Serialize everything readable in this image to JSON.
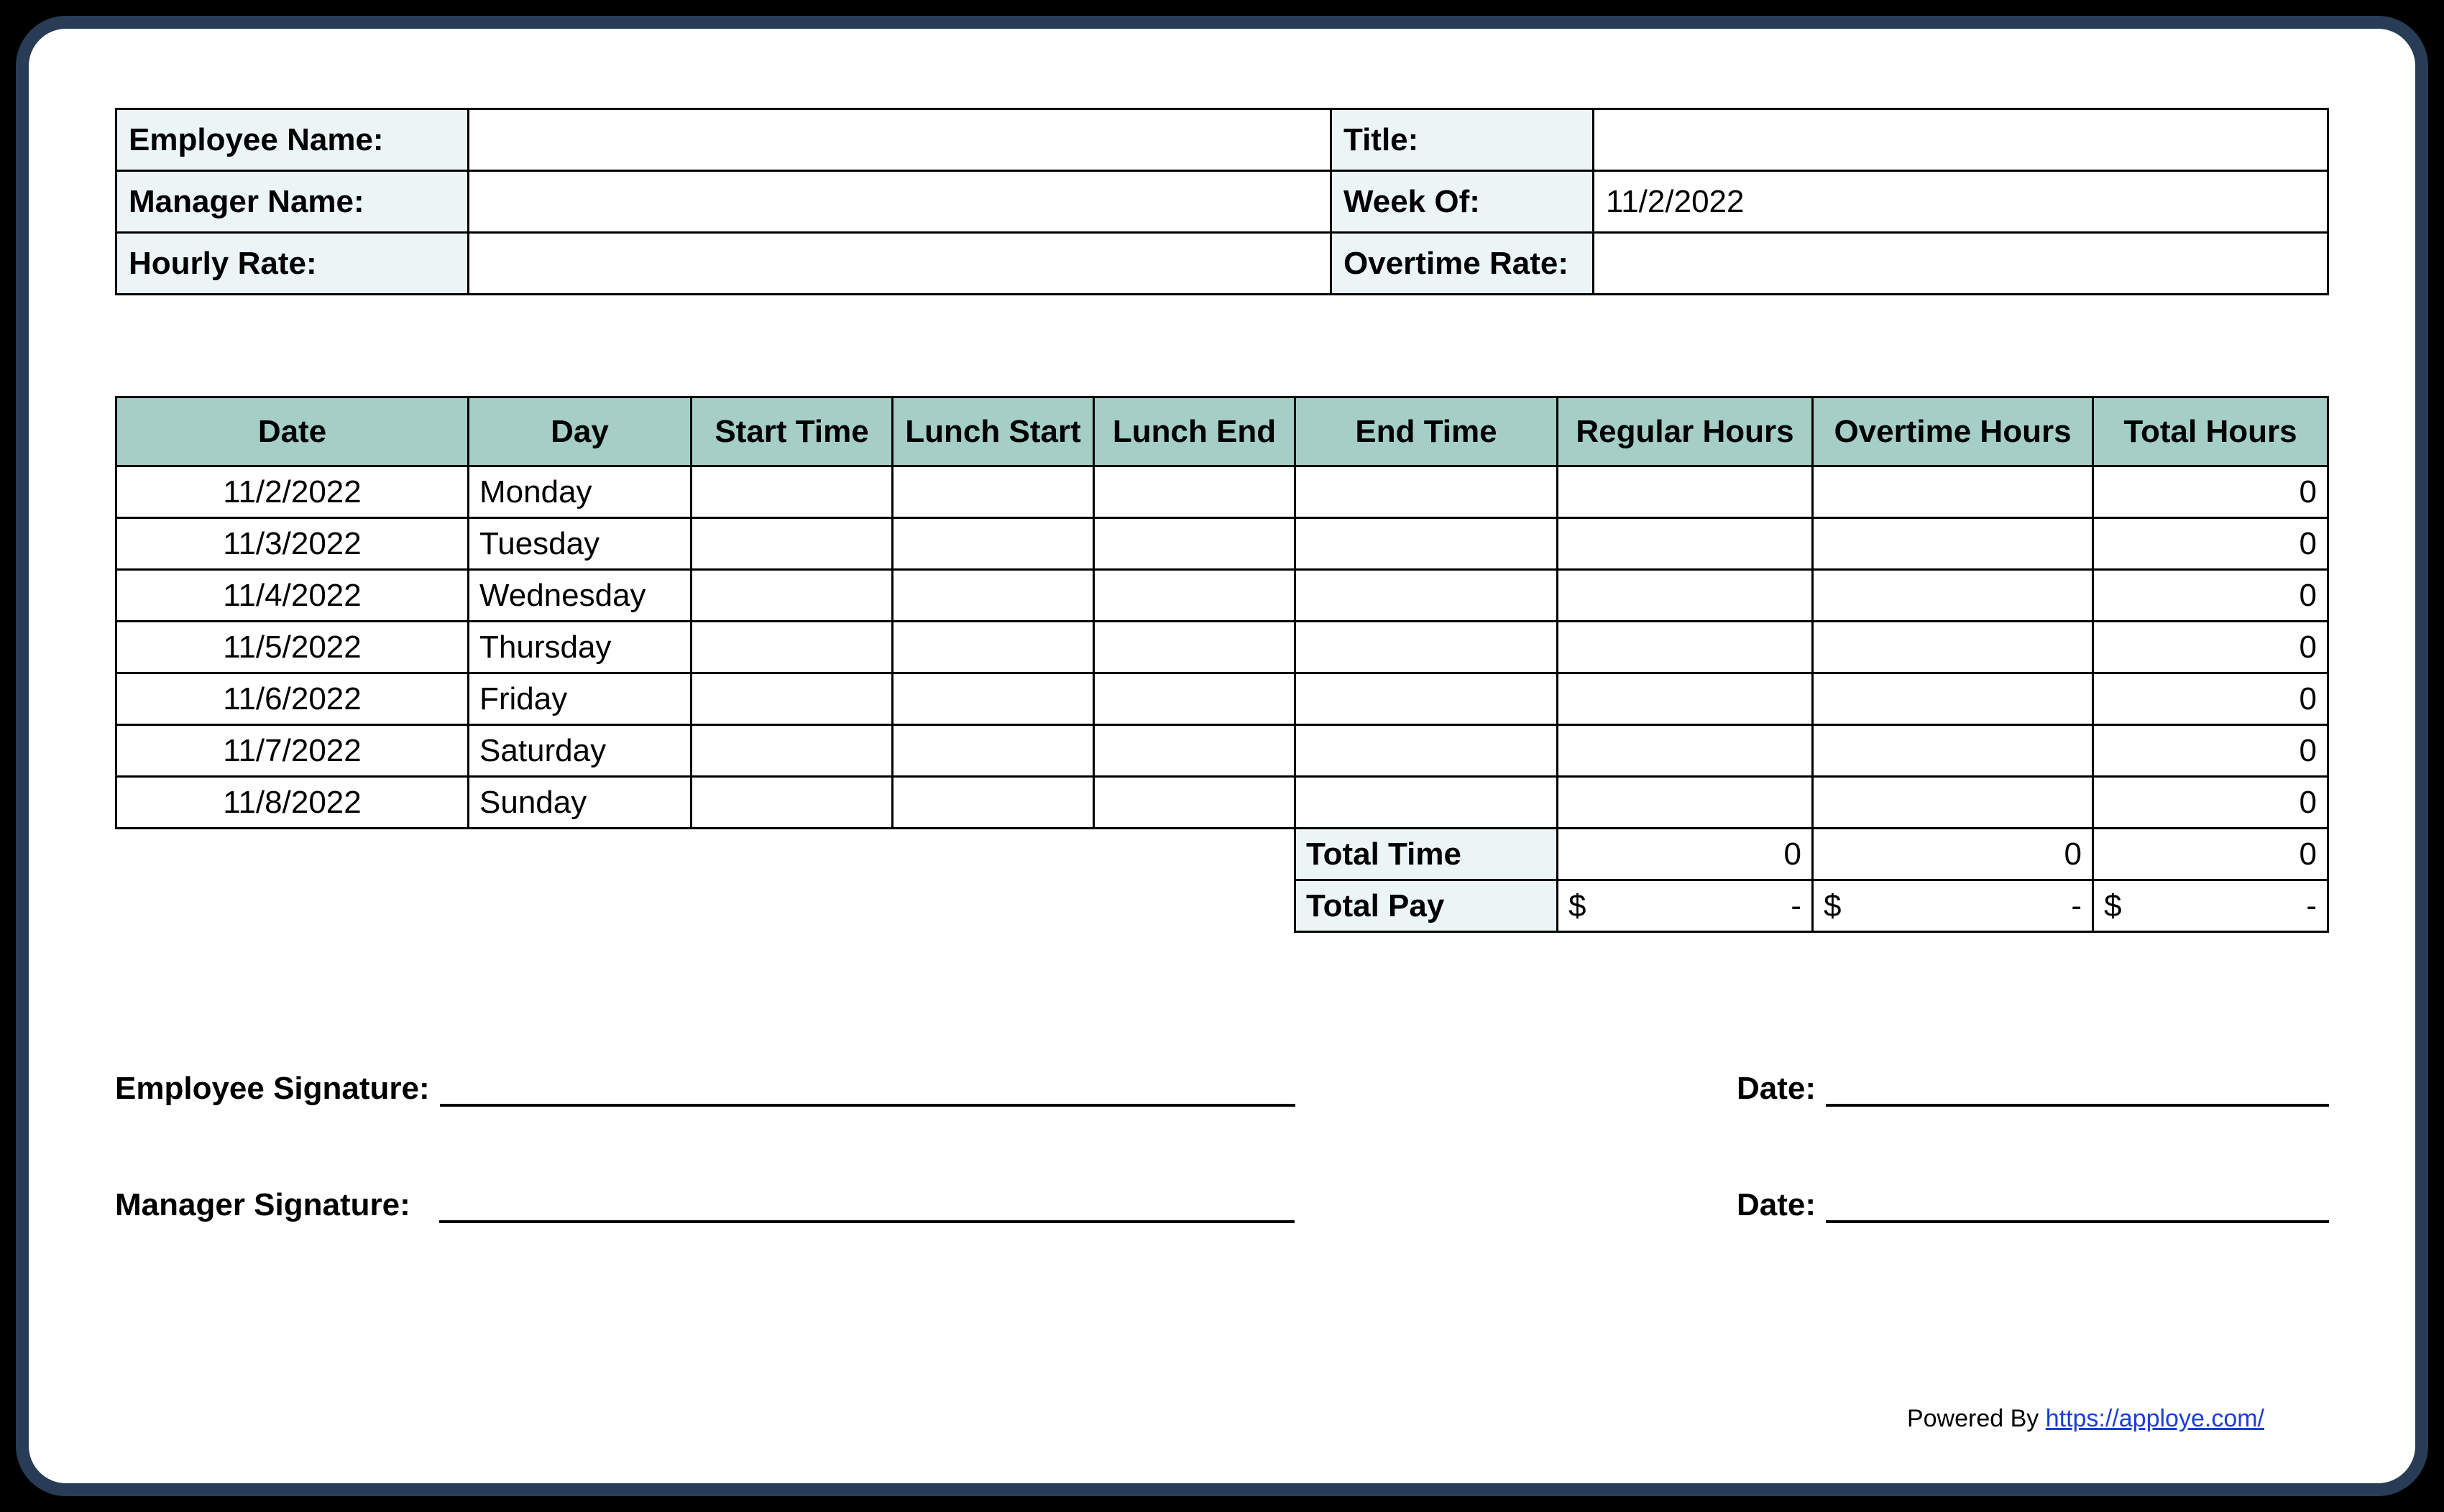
{
  "info": {
    "employee_name_label": "Employee Name:",
    "employee_name_value": "",
    "title_label": "Title:",
    "title_value": "",
    "manager_name_label": "Manager Name:",
    "manager_name_value": "",
    "week_of_label": "Week Of:",
    "week_of_value": "11/2/2022",
    "hourly_rate_label": "Hourly Rate:",
    "hourly_rate_value": "",
    "overtime_rate_label": "Overtime Rate:",
    "overtime_rate_value": ""
  },
  "headers": {
    "date": "Date",
    "day": "Day",
    "start_time": "Start Time",
    "lunch_start": "Lunch Start",
    "lunch_end": "Lunch End",
    "end_time": "End Time",
    "regular_hours": "Regular Hours",
    "overtime_hours": "Overtime Hours",
    "total_hours": "Total Hours"
  },
  "rows": [
    {
      "date": "11/2/2022",
      "day": "Monday",
      "start": "",
      "ls": "",
      "le": "",
      "end": "",
      "reg": "",
      "ot": "",
      "total": "0"
    },
    {
      "date": "11/3/2022",
      "day": "Tuesday",
      "start": "",
      "ls": "",
      "le": "",
      "end": "",
      "reg": "",
      "ot": "",
      "total": "0"
    },
    {
      "date": "11/4/2022",
      "day": "Wednesday",
      "start": "",
      "ls": "",
      "le": "",
      "end": "",
      "reg": "",
      "ot": "",
      "total": "0"
    },
    {
      "date": "11/5/2022",
      "day": "Thursday",
      "start": "",
      "ls": "",
      "le": "",
      "end": "",
      "reg": "",
      "ot": "",
      "total": "0"
    },
    {
      "date": "11/6/2022",
      "day": "Friday",
      "start": "",
      "ls": "",
      "le": "",
      "end": "",
      "reg": "",
      "ot": "",
      "total": "0"
    },
    {
      "date": "11/7/2022",
      "day": "Saturday",
      "start": "",
      "ls": "",
      "le": "",
      "end": "",
      "reg": "",
      "ot": "",
      "total": "0"
    },
    {
      "date": "11/8/2022",
      "day": "Sunday",
      "start": "",
      "ls": "",
      "le": "",
      "end": "",
      "reg": "",
      "ot": "",
      "total": "0"
    }
  ],
  "totals": {
    "total_time_label": "Total Time",
    "total_pay_label": "Total Pay",
    "reg_time": "0",
    "ot_time": "0",
    "total_time": "0",
    "currency": "$",
    "reg_pay": "-",
    "ot_pay": "-",
    "total_pay": "-"
  },
  "sig": {
    "emp_label": "Employee Signature:",
    "mgr_label": "Manager Signature:",
    "date_label": "Date:"
  },
  "footer": {
    "powered": "Powered By ",
    "url": "https://apploye.com/"
  }
}
